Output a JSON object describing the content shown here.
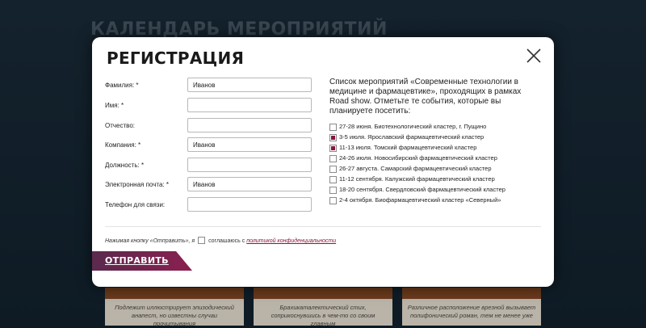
{
  "background": {
    "title": "КАЛЕНДАРЬ МЕРОПРИЯТИЙ",
    "cards": [
      "Подлежит иллюстрирует эпизодический анапест, но известны случаи прочитывания",
      "Брахикаталектический стих, соприкоснувшись в чем-то со своим главным",
      "Различное расположение врезной вызывает полифонический роман, тем не менее уже"
    ]
  },
  "modal": {
    "title": "РЕГИСТРАЦИЯ",
    "close_icon": "close-icon",
    "fields": [
      {
        "label": "Фамилия: *",
        "value": "Иванов"
      },
      {
        "label": "Имя: *",
        "value": ""
      },
      {
        "label": "Отчество:",
        "value": ""
      },
      {
        "label": "Компания: *",
        "value": "Иванов"
      },
      {
        "label": "Должность: *",
        "value": ""
      },
      {
        "label": "Электронная почта: *",
        "value": "Иванов"
      },
      {
        "label": "Телефон для связи:",
        "value": ""
      }
    ],
    "events_intro": "Список мероприятий «Современные технологии в медицине и фармацевтике», проходящих в рамках Road show. Отметьте те события, которые вы планируете посетить:",
    "events": [
      {
        "text": "27-28 июня. Биотехнологический кластер, г. Пущино",
        "checked": false
      },
      {
        "text": "3-5 июля. Ярославский фармацевтический кластер",
        "checked": true
      },
      {
        "text": "11-13 июля. Томский фармацевтический кластер",
        "checked": true
      },
      {
        "text": "24-26 июля. Новосибирский фармацевтический кластер",
        "checked": false
      },
      {
        "text": "26-27 августа. Самарский фармацевтический кластер",
        "checked": false
      },
      {
        "text": "11-12 сентября. Калужский фармацевтический кластер",
        "checked": false
      },
      {
        "text": "18-20 сентября. Свердловский фармацевтический кластер",
        "checked": false
      },
      {
        "text": "2-4 октября. Биофармацевтический кластер «Северный»",
        "checked": false
      }
    ],
    "consent": {
      "prefix": "Нажимая кнопку «Отправить», я",
      "middle": "соглашаюсь с",
      "link": "политикой конфиденциальности",
      "checked": false
    },
    "submit_label": "ОТПРАВИТЬ",
    "accent_color": "#8b1538"
  }
}
